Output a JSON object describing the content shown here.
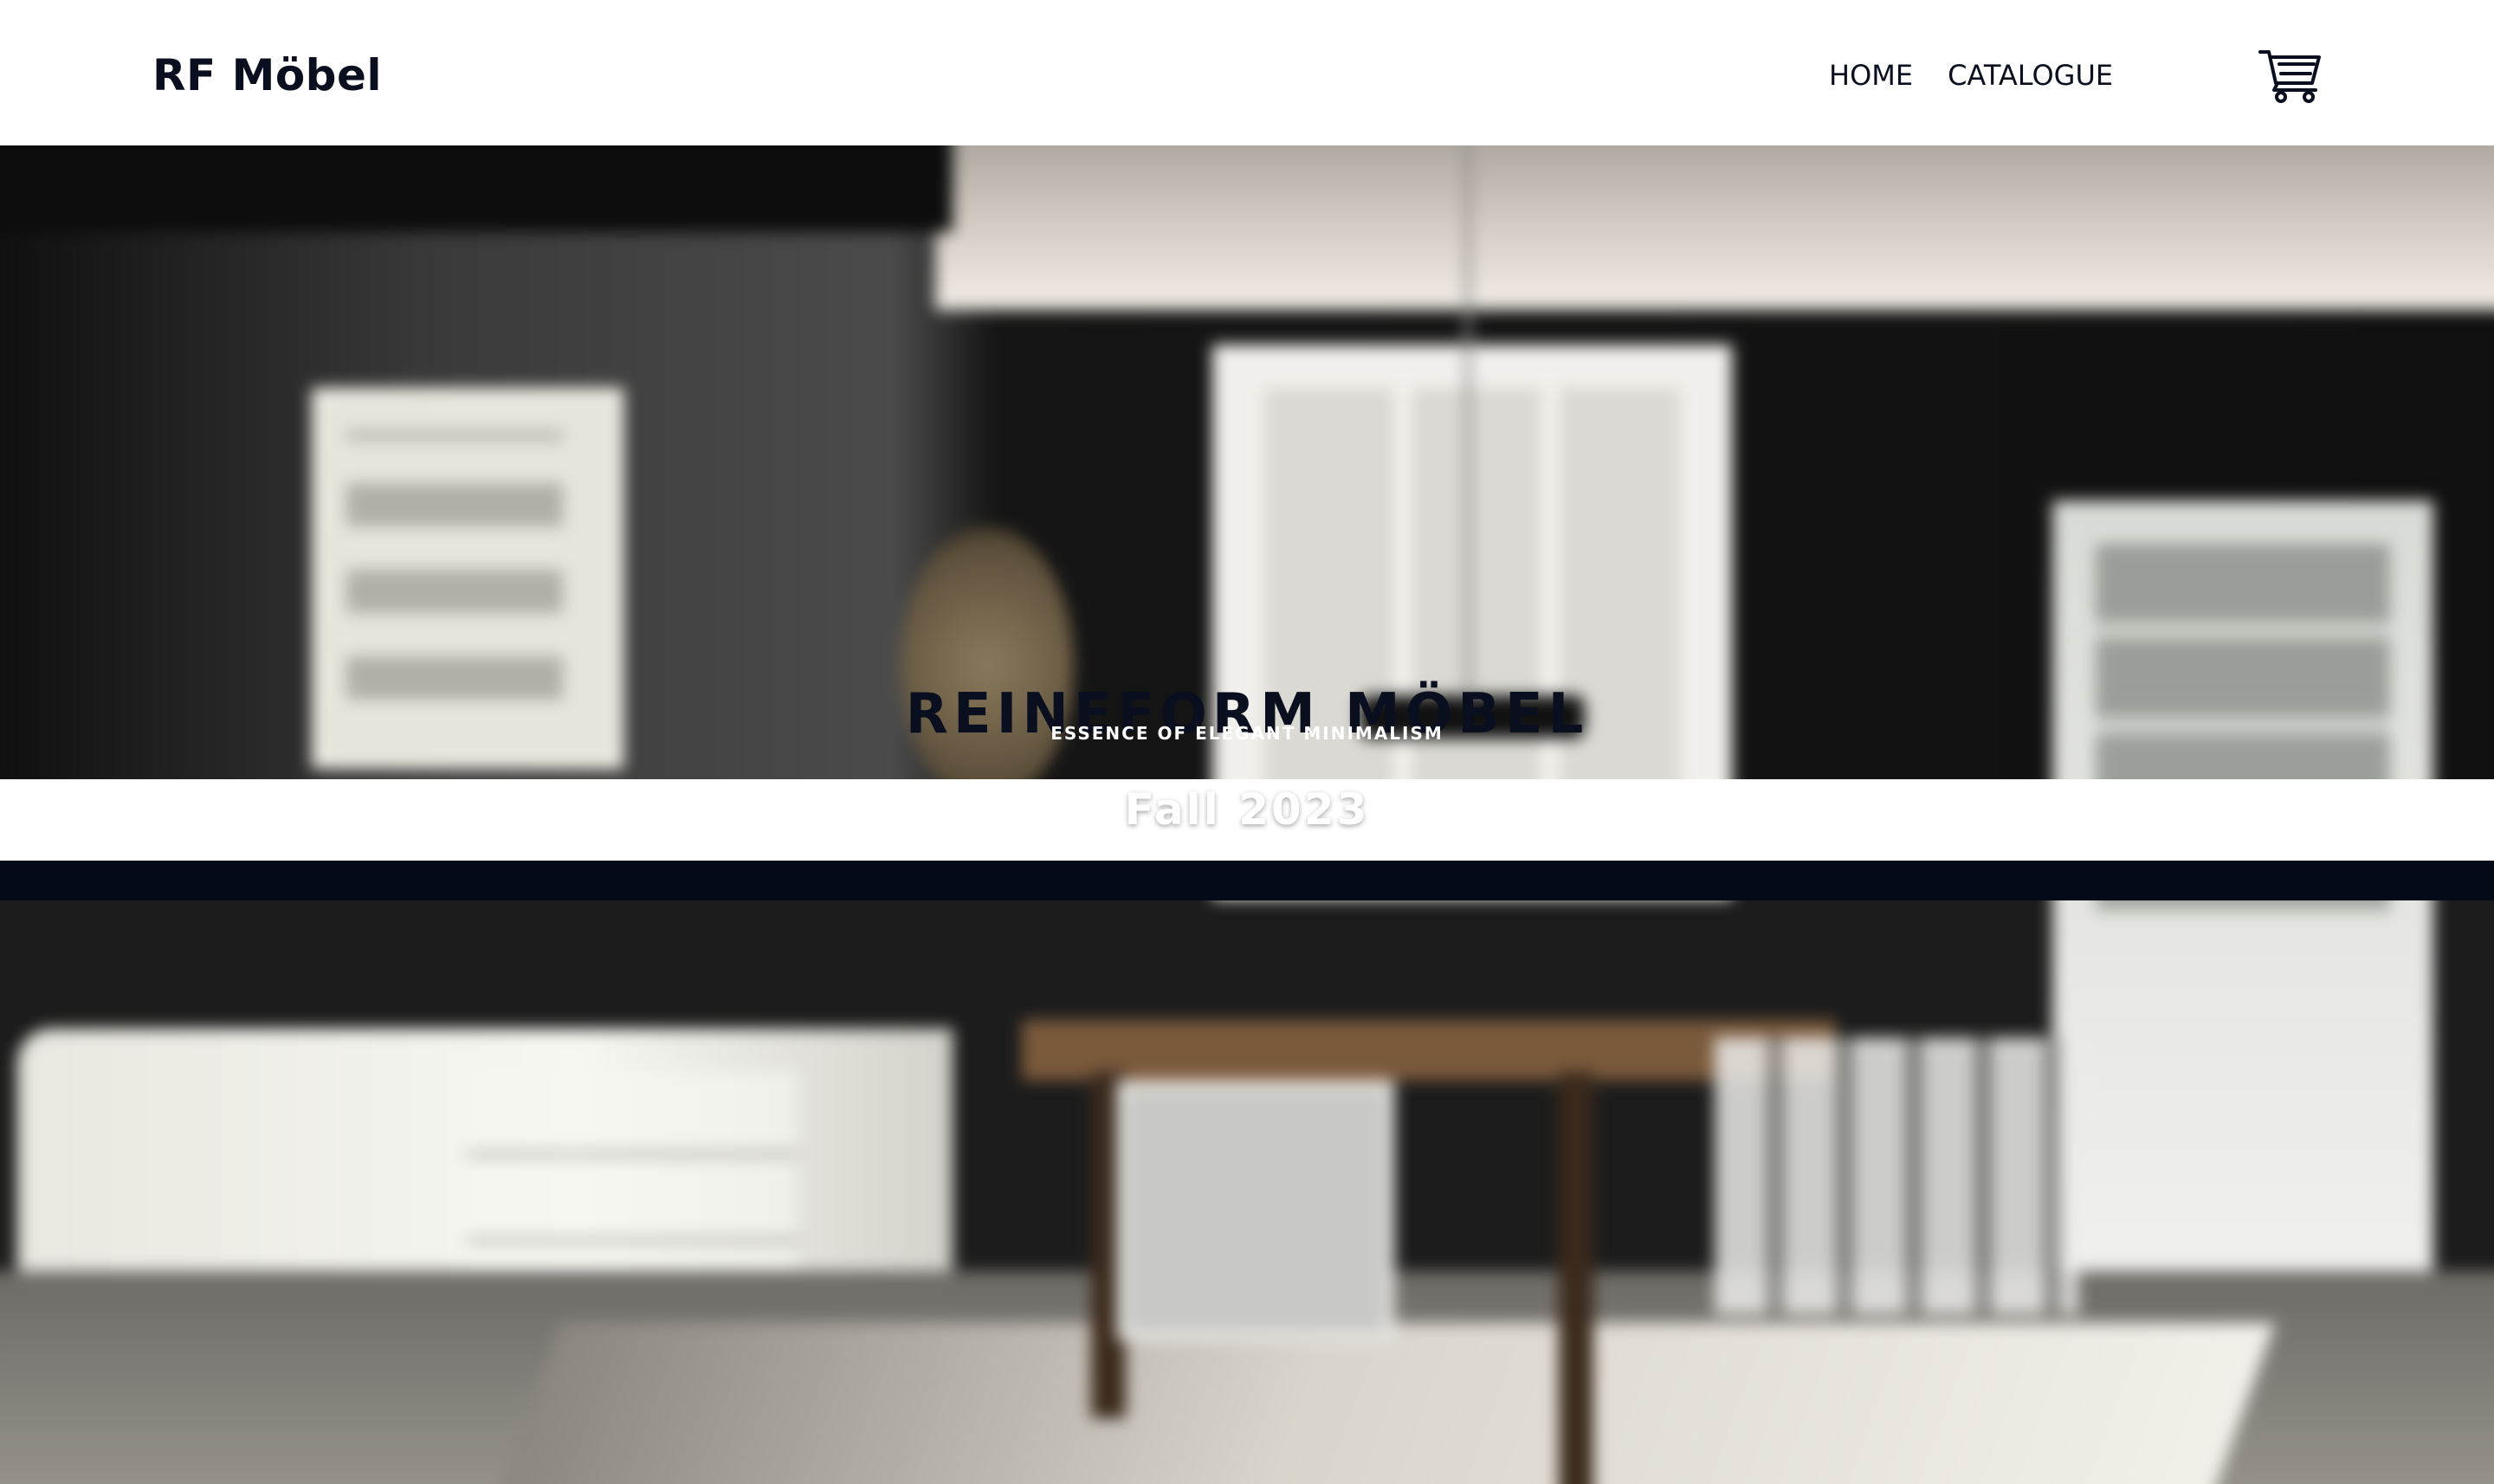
{
  "header": {
    "brand": "RF Möbel",
    "nav": [
      {
        "label": "HOME"
      },
      {
        "label": "CATALOGUE"
      }
    ],
    "cart_icon": "shopping-cart-icon"
  },
  "hero": {
    "title": "REINEFORM MÖBEL",
    "tagline": "ESSENCE OF ELEGANT MINIMALISM",
    "season": "Fall 2023"
  },
  "colors": {
    "brand_text": "#0a0f1f",
    "strip": "#050a18",
    "background": "#ffffff"
  }
}
